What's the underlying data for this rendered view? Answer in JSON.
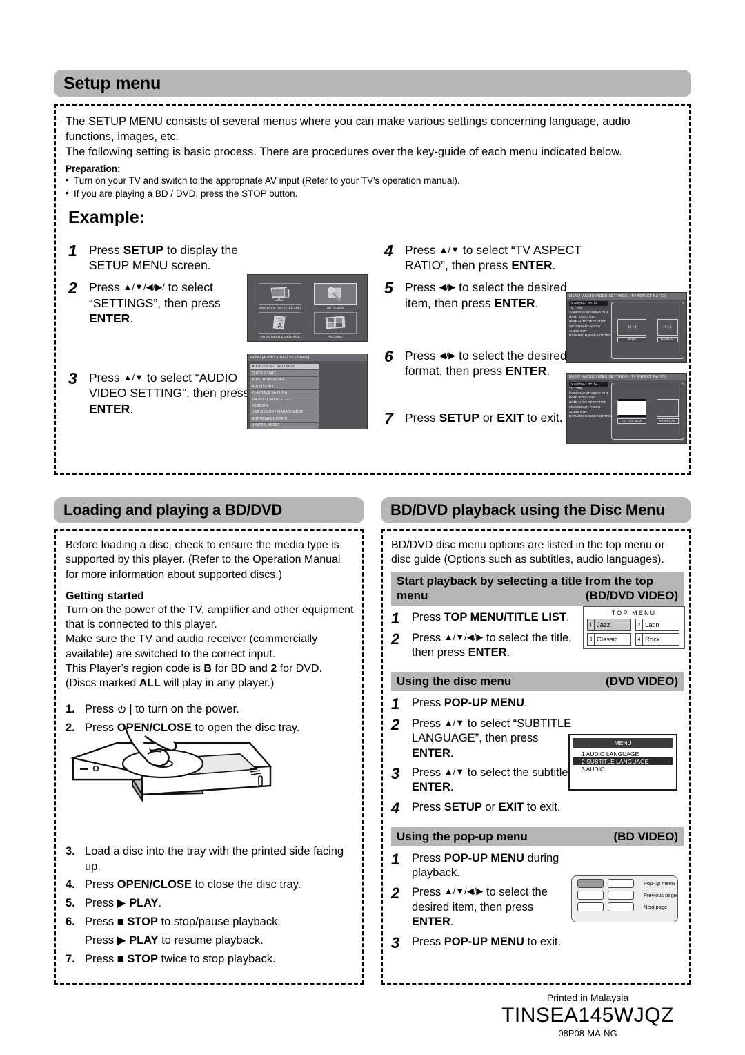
{
  "setup": {
    "heading": "Setup menu",
    "intro1": "The SETUP MENU consists of several menus where you can make various settings concerning language, audio functions, images, etc.",
    "intro2": "The following setting is basic process. There are procedures over the key-guide of each menu indicated below.",
    "preparation_label": "Preparation:",
    "prep_bullets": [
      "Turn on your TV and switch to the appropriate AV input (Refer to your TV's operation manual).",
      "If you are playing a BD / DVD, press the STOP button."
    ],
    "example_label": "Example:",
    "steps_left": [
      {
        "num": "1",
        "text": "Press SETUP to display the SETUP MENU screen."
      },
      {
        "num": "2",
        "text": "Press ▲/▼/◀/▶/ to select “SETTINGS”, then press ENTER."
      },
      {
        "num": "3",
        "text": "Press ▲/▼ to select “AUDIO VIDEO SETTING”, then press ENTER."
      }
    ],
    "steps_right": [
      {
        "num": "4",
        "text": "Press ▲/▼ to select “TV ASPECT RATIO”, then press ENTER."
      },
      {
        "num": "5",
        "text": "Press ◀/▶ to select the desired item, then press ENTER."
      },
      {
        "num": "6",
        "text": "Press ◀/▶ to select the desired format, then press ENTER."
      },
      {
        "num": "7",
        "text": "Press SETUP or EXIT to exit."
      }
    ],
    "osd_settings_grid": {
      "cells": [
        {
          "caption": "DISPLAYS THE TITLE LIST",
          "icon": "tv-title-list-icon",
          "selected": false
        },
        {
          "caption": "SETTINGS",
          "icon": "wrench-settings-icon",
          "selected": true
        },
        {
          "caption": "ON SCREEN LANGUAGE",
          "icon": "language-page-icon",
          "selected": false
        },
        {
          "caption": "PICTURE",
          "icon": "picture-gallery-icon",
          "selected": false
        }
      ]
    },
    "osd_av_list": {
      "title": "MENU   [AUDIO VIDEO SETTINGS]",
      "items": [
        "AUDIO VIDEO SETTINGS",
        "QUICK START",
        "AUTO POWER OFF",
        "AQUOS LINK",
        "PLAYBACK SETTING",
        "FRONT DISPLAY / LED",
        "VERSION",
        "USB MEMORY MANAGEMENT",
        "SOFTWARE UPDATE",
        "SYSTEM RESET"
      ],
      "selected_index": 0
    },
    "osd_aspect": {
      "title": "MENU   [AUDIO VIDEO SETTINGS -  TV ASPECT RATIO]",
      "items": [
        "TV ASPECT RATIO",
        "TV TYPE",
        "COMPONENT VIDEO OUT",
        "HDMI VIDEO OUT",
        "HDMI AUTO DETECTION",
        "SECONDARY AUDIO",
        "AUDIO OUT",
        "DYNAMIC RANGE CONTROL"
      ],
      "selected_index": 0,
      "screen1": {
        "opt1_screen": "16 : 9",
        "opt1_label": "WIDE",
        "opt2_screen": "4 : 3",
        "opt2_label": "NORMAL"
      },
      "screen2": {
        "opt1_label": "LETTER BOX",
        "opt2_label": "PAN SCAN"
      }
    }
  },
  "loading": {
    "heading": "Loading and playing a BD/DVD",
    "intro": "Before loading a disc, check to ensure the media type is supported by this player. (Refer to the Operation Manual for more information about supported discs.)",
    "getting_started_label": "Getting started",
    "gs_paragraphs": [
      "Turn on the power of the TV, amplifier and other equipment that is connected to this player.",
      "Make sure the TV and audio receiver (commercially available) are switched to the correct input.",
      "This Player's region code is B for BD and 2 for DVD. (Discs marked ALL will play in any player.)"
    ],
    "steps_before_art": [
      {
        "num": "1.",
        "text": "Press ⏻ | to turn on the power."
      },
      {
        "num": "2.",
        "text": "Press OPEN/CLOSE to open the disc tray."
      }
    ],
    "steps_after_art": [
      {
        "num": "3.",
        "text": "Load a disc into the tray with the printed side facing up."
      },
      {
        "num": "4.",
        "text": "Press OPEN/CLOSE to close the disc tray."
      },
      {
        "num": "5.",
        "text": "Press ▶ PLAY."
      },
      {
        "num": "6.",
        "text": "Press ■ STOP to stop/pause playback."
      },
      {
        "num": "",
        "text": "Press ▶ PLAY to resume playback."
      },
      {
        "num": "7.",
        "text": "Press ■ STOP twice to stop playback."
      }
    ]
  },
  "disc": {
    "heading": "BD/DVD playback using the Disc Menu",
    "intro": "BD/DVD disc menu options are listed in the top menu or disc guide (Options such as subtitles, audio languages).",
    "sections": [
      {
        "title": "Start playback by selecting a title from the top menu",
        "tag": "(BD/DVD VIDEO)",
        "steps": [
          {
            "num": "1",
            "text": "Press TOP MENU/TITLE LIST."
          },
          {
            "num": "2",
            "text": "Press ▲/▼/◀/▶ to select the title, then press ENTER."
          }
        ]
      },
      {
        "title": "Using the disc menu",
        "tag": "(DVD VIDEO)",
        "steps": [
          {
            "num": "1",
            "text": "Press POP-UP MENU."
          },
          {
            "num": "2",
            "text": "Press ▲/▼ to select “SUBTITLE LANGUAGE”, then press ENTER."
          },
          {
            "num": "3",
            "text": "Press ▲/▼ to select the subtitle language, then press ENTER."
          },
          {
            "num": "4",
            "text": "Press SETUP or EXIT to exit."
          }
        ]
      },
      {
        "title": "Using the pop-up menu",
        "tag": "(BD VIDEO)",
        "steps": [
          {
            "num": "1",
            "text": "Press POP-UP MENU during playback."
          },
          {
            "num": "2",
            "text": "Press ▲/▼/◀/▶ to select the desired item, then press ENTER."
          },
          {
            "num": "3",
            "text": "Press POP-UP MENU to exit."
          }
        ]
      }
    ],
    "top_menu_graphic": {
      "title": "TOP MENU",
      "cells": [
        {
          "idx": "1",
          "label": "Jazz",
          "selected": true
        },
        {
          "idx": "2",
          "label": "Latin",
          "selected": false
        },
        {
          "idx": "3",
          "label": "Classic",
          "selected": false
        },
        {
          "idx": "4",
          "label": "Rock",
          "selected": false
        }
      ]
    },
    "dvd_menu_graphic": {
      "title": "MENU",
      "rows": [
        {
          "idx": "1",
          "label": "AUDIO LANGUAGE",
          "selected": false
        },
        {
          "idx": "2",
          "label": "SUBTITLE LANGUAGE",
          "selected": true
        },
        {
          "idx": "3",
          "label": "AUDIO",
          "selected": false
        }
      ]
    },
    "popup_graphic": {
      "labels": [
        "Pop-up menu",
        "Previous page",
        "Next page"
      ]
    }
  },
  "footer": {
    "printed": "Printed in Malaysia",
    "part_number": "TINSEA145WJQZ",
    "doc_code": "08P08-MA-NG"
  },
  "colors": {
    "pill_gray": "#b6b6b6",
    "osd_bg": "#555558",
    "osd_row": "#86868a",
    "osd_row_selected": "#c9c9cd"
  }
}
